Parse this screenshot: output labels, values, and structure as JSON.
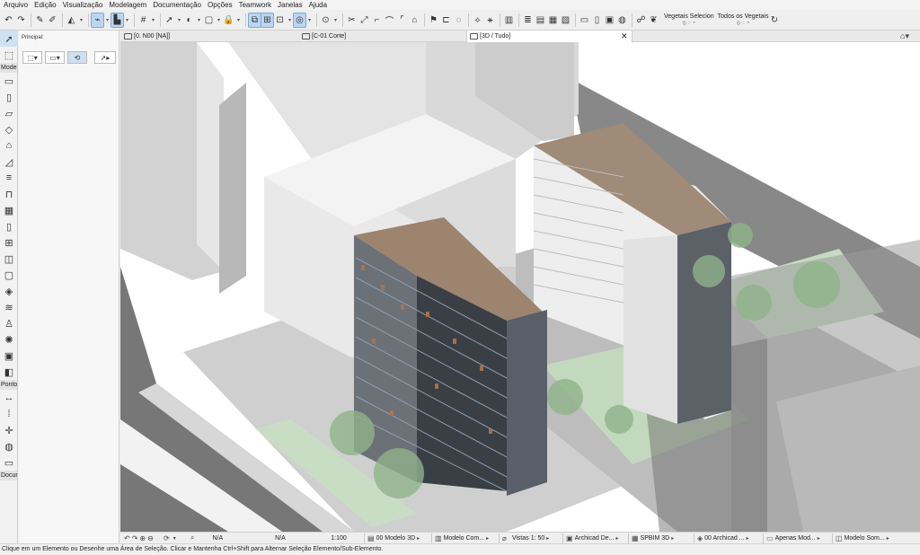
{
  "menu": [
    "Arquivo",
    "Edição",
    "Visualização",
    "Modelagem",
    "Documentação",
    "Opções",
    "Teamwork",
    "Janelas",
    "Ajuda"
  ],
  "toolbar": {
    "icons": [
      "undo-icon",
      "redo-icon",
      "sep",
      "pick-up-icon",
      "inject-icon",
      "sep",
      "layer-icon",
      "dd",
      "sep",
      "active-line-icon",
      "dd",
      "floor-icon",
      "dd",
      "sep",
      "grid-snap-icon",
      "dd",
      "sep",
      "cursor-icon",
      "dd",
      "eye-icon",
      "dd",
      "cube-icon",
      "dd",
      "lock-icon",
      "dd",
      "sep",
      "group-icon",
      "ungroup-icon",
      "suspend-icon",
      "dd",
      "element-icon",
      "dd",
      "sep",
      "circle-icon",
      "dd",
      "sep",
      "split-icon",
      "adjust-icon",
      "trim-icon",
      "fillet-icon",
      "offset-icon",
      "roof-icon",
      "sep",
      "flag-icon",
      "ruler-icon",
      "tag-icon",
      "sep",
      "magic-icon",
      "wand-icon",
      "sep",
      "panel-icon",
      "sep",
      "stack-icon",
      "layers-icon",
      "stack2-icon",
      "books-icon",
      "sep",
      "window-icon",
      "window2-icon",
      "window3-icon",
      "globe-icon",
      "sep",
      "walk-icon",
      "tree-icon"
    ],
    "renov_label_1": "Vegetais Selecion",
    "renov_label_2": "Todos os Vegetais"
  },
  "toolbox": {
    "groups": [
      {
        "label": "Model",
        "tools": [
          "wall-icon",
          "column-icon",
          "beam-icon",
          "slab-icon",
          "roof-tool-icon",
          "shell-icon",
          "stair-icon",
          "railing-icon",
          "curtain-wall-icon",
          "door-icon",
          "window-tool-icon",
          "skylight-icon",
          "corner-window-icon",
          "morph-icon",
          "mesh-icon",
          "object-icon",
          "lamp-icon",
          "zone-icon",
          "opening-icon"
        ]
      },
      {
        "label": "Ponto",
        "tools": [
          "dimension-icon",
          "point-icon",
          "camera-icon",
          "drawing-icon",
          "figure-icon"
        ]
      },
      {
        "label": "Docun",
        "tools": []
      }
    ]
  },
  "infobox": {
    "label": "Principal:"
  },
  "tabs": [
    {
      "label": "[0. N00 [NA]]",
      "active": false
    },
    {
      "label": "[C-01 Corte]",
      "active": false
    },
    {
      "label": "[3D / Tudo]",
      "active": true
    }
  ],
  "tab_close": "✕",
  "navbar": {
    "zoom1": "N/A",
    "zoom2": "N/A",
    "scale": "1:100",
    "model_view": "00 Modelo 3D",
    "pen_set": "Modelo Com...",
    "view_set": "Vistas 1: 50",
    "mvo": "Archicad De...",
    "renovation": "SPBIM 3D",
    "graphic_override": "00 Archicad ...",
    "dimension": "Apenas Mod...",
    "structure": "Modelo Som..."
  },
  "status": "Clique em um Elemento ou Desenhe uma Área de Seleção. Clicar e Mantenha Ctrl+Shift para Alternar Seleção Elemento/Sub-Elemento.",
  "colors": {
    "selected_tool": "#cfe0f3",
    "toolbar_active": "#bcd5f0",
    "building_facade": "#3a3f46",
    "context_mass": "#d8d8d8",
    "vegetation": "#a9c9a4"
  }
}
